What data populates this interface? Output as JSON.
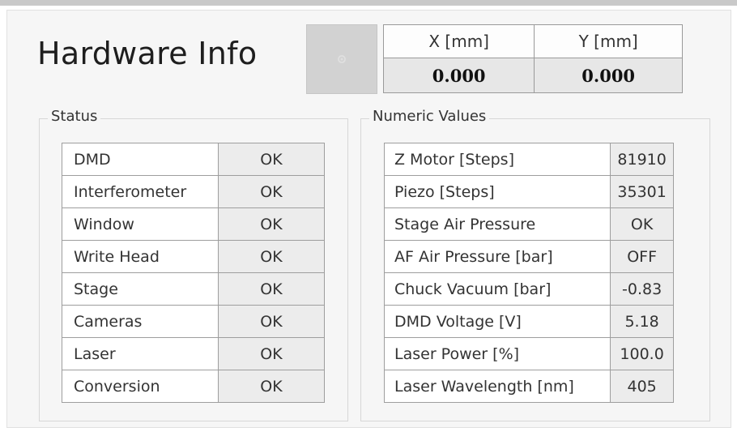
{
  "title": "Hardware Info",
  "settings_button": {
    "icon": "gear-icon"
  },
  "coordinates": {
    "headers": [
      "X [mm]",
      "Y [mm]"
    ],
    "values": [
      "0.000",
      "0.000"
    ]
  },
  "status": {
    "label": "Status",
    "rows": [
      {
        "name": "DMD",
        "value": "OK"
      },
      {
        "name": "Interferometer",
        "value": "OK"
      },
      {
        "name": "Window",
        "value": "OK"
      },
      {
        "name": "Write Head",
        "value": "OK"
      },
      {
        "name": "Stage",
        "value": "OK"
      },
      {
        "name": "Cameras",
        "value": "OK"
      },
      {
        "name": "Laser",
        "value": "OK"
      },
      {
        "name": "Conversion",
        "value": "OK"
      }
    ]
  },
  "numeric": {
    "label": "Numeric Values",
    "rows": [
      {
        "name": "Z Motor [Steps]",
        "value": "81910"
      },
      {
        "name": "Piezo [Steps]",
        "value": "35301"
      },
      {
        "name": "Stage Air Pressure",
        "value": "OK"
      },
      {
        "name": "AF Air Pressure [bar]",
        "value": "OFF"
      },
      {
        "name": "Chuck Vacuum [bar]",
        "value": "-0.83"
      },
      {
        "name": "DMD Voltage [V]",
        "value": "5.18"
      },
      {
        "name": "Laser Power [%]",
        "value": "100.0"
      },
      {
        "name": "Laser Wavelength [nm]",
        "value": "405"
      }
    ]
  }
}
